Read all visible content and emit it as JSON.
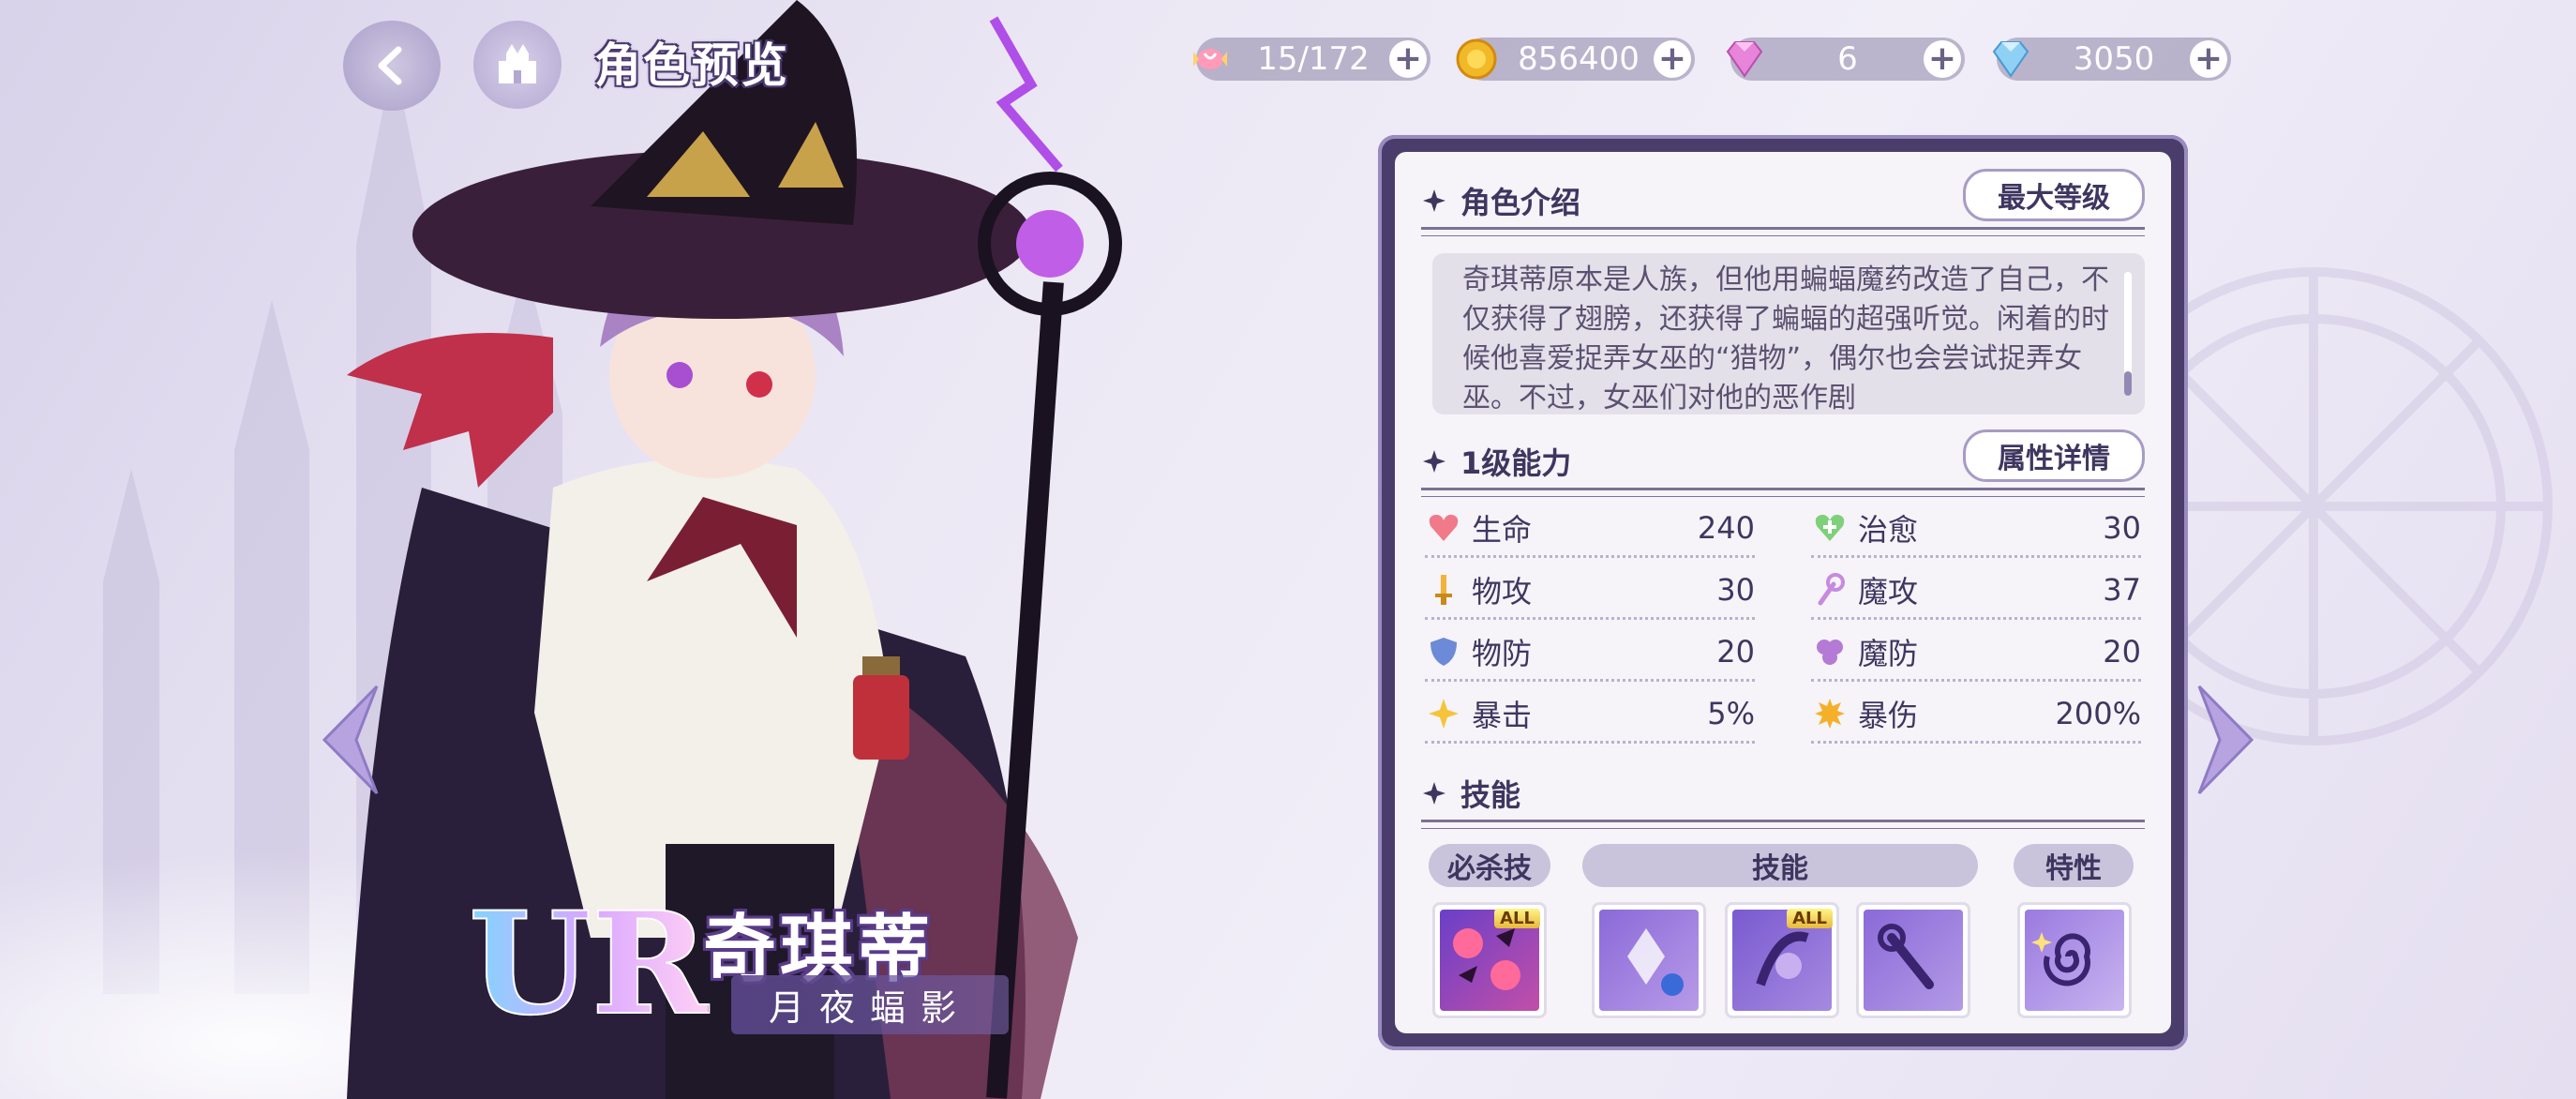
{
  "header": {
    "title": "角色预览",
    "currencies": [
      {
        "icon": "candy-icon",
        "value": "15/172"
      },
      {
        "icon": "gold-coin-icon",
        "value": "856400"
      },
      {
        "icon": "pink-gem-icon",
        "value": "6"
      },
      {
        "icon": "diamond-icon",
        "value": "3050"
      }
    ]
  },
  "character": {
    "rarity": "UR",
    "name": "奇琪蒂",
    "title": "月夜蝠影"
  },
  "panel": {
    "intro": {
      "heading": "角色介绍",
      "max_level_button": "最大等级",
      "description": "奇琪蒂原本是人族，但他用蝙蝠魔药改造了自己，不仅获得了翅膀，还获得了蝙蝠的超强听觉。闲着的时候他喜爱捉弄女巫的“猎物”，偶尔也会尝试捉弄女巫。不过，女巫们对他的恶作剧"
    },
    "abilities": {
      "heading": "1级能力",
      "detail_button": "属性详情",
      "stats": [
        {
          "icon": "heart-icon",
          "label": "生命",
          "value": "240"
        },
        {
          "icon": "heal-icon",
          "label": "治愈",
          "value": "30"
        },
        {
          "icon": "sword-icon",
          "label": "物攻",
          "value": "30"
        },
        {
          "icon": "magic-wand-icon",
          "label": "魔攻",
          "value": "37"
        },
        {
          "icon": "shield-icon",
          "label": "物防",
          "value": "20"
        },
        {
          "icon": "magic-shield-icon",
          "label": "魔防",
          "value": "20"
        },
        {
          "icon": "crit-icon",
          "label": "暴击",
          "value": "5%"
        },
        {
          "icon": "crit-damage-icon",
          "label": "暴伤",
          "value": "200%"
        }
      ]
    },
    "skills": {
      "heading": "技能",
      "tabs": [
        "必杀技",
        "技能",
        "特性"
      ],
      "all_tag": "ALL"
    }
  },
  "colors": {
    "panel_frame": "#4b3d6b",
    "panel_bg": "#f6f4f8",
    "accent": "#9389b4"
  }
}
